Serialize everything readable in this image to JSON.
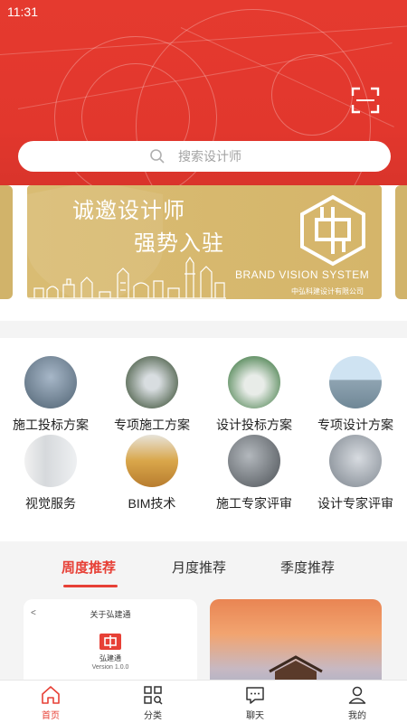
{
  "status_bar": {
    "time": "11:31"
  },
  "search": {
    "placeholder": "搜索设计师"
  },
  "banner": {
    "line1": "诚邀设计师",
    "line2": "强势入驻",
    "brand": "BRAND VISION SYSTEM",
    "company": "中弘科建设计有限公司"
  },
  "categories": [
    {
      "label": "施工投标方案"
    },
    {
      "label": "专项施工方案"
    },
    {
      "label": "设计投标方案"
    },
    {
      "label": "专项设计方案"
    },
    {
      "label": "视觉服务"
    },
    {
      "label": "BIM技术"
    },
    {
      "label": "施工专家评审"
    },
    {
      "label": "设计专家评审"
    }
  ],
  "tabs": [
    {
      "label": "周度推荐"
    },
    {
      "label": "月度推荐"
    },
    {
      "label": "季度推荐"
    }
  ],
  "card_left": {
    "back": "<",
    "title": "关于弘建通",
    "app_name": "弘建通",
    "version": "Version 1.0.0"
  },
  "bottom_nav": [
    {
      "label": "首页",
      "icon": "home-icon"
    },
    {
      "label": "分类",
      "icon": "category-icon"
    },
    {
      "label": "聊天",
      "icon": "chat-icon"
    },
    {
      "label": "我的",
      "icon": "profile-icon"
    }
  ],
  "colors": {
    "accent": "#e74036",
    "header": "#e53a2f",
    "banner_gold": "#d5b56a"
  }
}
